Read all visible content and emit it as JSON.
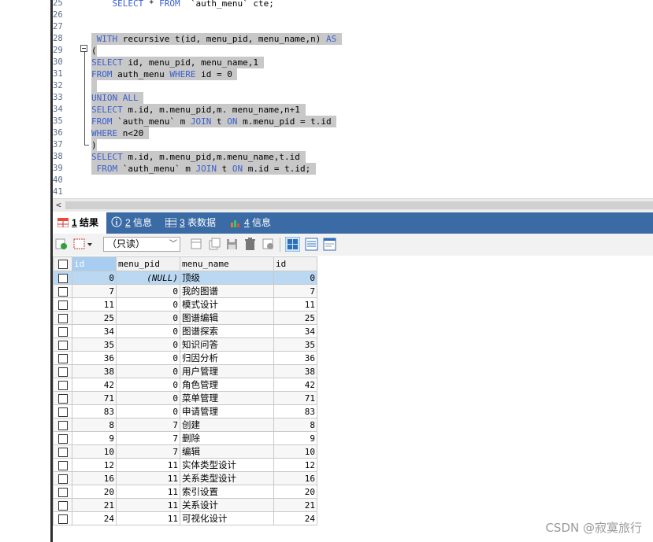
{
  "editor": {
    "lines": [
      {
        "n": "25",
        "segs": [
          {
            "t": "    ",
            "k": 0
          },
          {
            "t": "SELECT",
            "k": 1
          },
          {
            "t": " * ",
            "k": 0
          },
          {
            "t": "FROM",
            "k": 1
          },
          {
            "t": "  `auth_menu` cte;",
            "k": 0
          }
        ],
        "sel": false
      },
      {
        "n": "26",
        "segs": [],
        "sel": false
      },
      {
        "n": "27",
        "segs": [],
        "sel": false
      },
      {
        "n": "28",
        "segs": [
          {
            "t": " ",
            "k": 0
          },
          {
            "t": "WITH",
            "k": 1
          },
          {
            "t": " recursive t(id, menu_pid, menu_name,n) ",
            "k": 0
          },
          {
            "t": "AS",
            "k": 1
          },
          {
            "t": " ",
            "k": 0
          }
        ],
        "sel": true
      },
      {
        "n": "29",
        "segs": [
          {
            "t": "(",
            "k": 0
          }
        ],
        "sel": true
      },
      {
        "n": "30",
        "segs": [
          {
            "t": "SELECT",
            "k": 1
          },
          {
            "t": " id, menu_pid, menu_name,1 ",
            "k": 0
          }
        ],
        "sel": true
      },
      {
        "n": "31",
        "segs": [
          {
            "t": "FROM",
            "k": 1
          },
          {
            "t": " auth_menu ",
            "k": 0
          },
          {
            "t": "WHERE",
            "k": 1
          },
          {
            "t": " id = 0 ",
            "k": 0
          }
        ],
        "sel": true
      },
      {
        "n": "32",
        "segs": [
          {
            "t": " ",
            "k": 0
          }
        ],
        "sel": true
      },
      {
        "n": "33",
        "segs": [
          {
            "t": "UNION ALL",
            "k": 1
          },
          {
            "t": " ",
            "k": 0
          }
        ],
        "sel": true
      },
      {
        "n": "34",
        "segs": [
          {
            "t": "SELECT",
            "k": 1
          },
          {
            "t": " m.id, m.menu_pid,m. menu_name,n+1 ",
            "k": 0
          }
        ],
        "sel": true
      },
      {
        "n": "35",
        "segs": [
          {
            "t": "FROM",
            "k": 1
          },
          {
            "t": " `auth_menu` m ",
            "k": 0
          },
          {
            "t": "JOIN",
            "k": 1
          },
          {
            "t": " t ",
            "k": 0
          },
          {
            "t": "ON",
            "k": 1
          },
          {
            "t": " m.menu_pid = t.id ",
            "k": 0
          }
        ],
        "sel": true
      },
      {
        "n": "36",
        "segs": [
          {
            "t": "WHERE",
            "k": 1
          },
          {
            "t": " n<20 ",
            "k": 0
          }
        ],
        "sel": true
      },
      {
        "n": "37",
        "segs": [
          {
            "t": ")",
            "k": 0
          }
        ],
        "sel": true
      },
      {
        "n": "38",
        "segs": [
          {
            "t": "SELECT",
            "k": 1
          },
          {
            "t": " m.id, m.menu_pid,m.menu_name,t.id ",
            "k": 0
          }
        ],
        "sel": true
      },
      {
        "n": "39",
        "segs": [
          {
            "t": " ",
            "k": 0
          },
          {
            "t": "FROM",
            "k": 1
          },
          {
            "t": " `auth_menu` m ",
            "k": 0
          },
          {
            "t": "JOIN",
            "k": 1
          },
          {
            "t": " t ",
            "k": 0
          },
          {
            "t": "ON",
            "k": 1
          },
          {
            "t": " m.id = t.id; ",
            "k": 0
          }
        ],
        "sel": true
      },
      {
        "n": "40",
        "segs": [],
        "sel": false
      },
      {
        "n": "41",
        "segs": [],
        "sel": false
      }
    ]
  },
  "scroll": {
    "left_arrow": "<"
  },
  "tabs": [
    {
      "num": "1",
      "label": "结果",
      "icon": "result-grid-icon"
    },
    {
      "num": "2",
      "label": "信息",
      "icon": "info-icon"
    },
    {
      "num": "3",
      "label": "表数据",
      "icon": "table-data-icon"
    },
    {
      "num": "4",
      "label": "信息",
      "icon": "info-chart-icon"
    }
  ],
  "toolbar": {
    "mode_select": "（只读）"
  },
  "grid": {
    "columns": [
      "id",
      "menu_pid",
      "menu_name",
      "id"
    ],
    "rows": [
      [
        "0",
        "(NULL)",
        "顶级",
        "0"
      ],
      [
        "7",
        "0",
        "我的图谱",
        "7"
      ],
      [
        "11",
        "0",
        "模式设计",
        "11"
      ],
      [
        "25",
        "0",
        "图谱编辑",
        "25"
      ],
      [
        "34",
        "0",
        "图谱探索",
        "34"
      ],
      [
        "35",
        "0",
        "知识问答",
        "35"
      ],
      [
        "36",
        "0",
        "归因分析",
        "36"
      ],
      [
        "38",
        "0",
        "用户管理",
        "38"
      ],
      [
        "42",
        "0",
        "角色管理",
        "42"
      ],
      [
        "71",
        "0",
        "菜单管理",
        "71"
      ],
      [
        "83",
        "0",
        "申请管理",
        "83"
      ],
      [
        "8",
        "7",
        "创建",
        "8"
      ],
      [
        "9",
        "7",
        "删除",
        "9"
      ],
      [
        "10",
        "7",
        "编辑",
        "10"
      ],
      [
        "12",
        "11",
        "实体类型设计",
        "12"
      ],
      [
        "16",
        "11",
        "关系类型设计",
        "16"
      ],
      [
        "20",
        "11",
        "索引设置",
        "20"
      ],
      [
        "21",
        "11",
        "关系设计",
        "21"
      ],
      [
        "24",
        "11",
        "可视化设计",
        "24"
      ]
    ]
  },
  "watermark": "CSDN @寂寞旅行",
  "colors": {
    "accent": "#3b6ba5",
    "keyword": "#3a5fcd",
    "selection": "#c8c8c8",
    "selected_row": "#bbd8f2"
  }
}
